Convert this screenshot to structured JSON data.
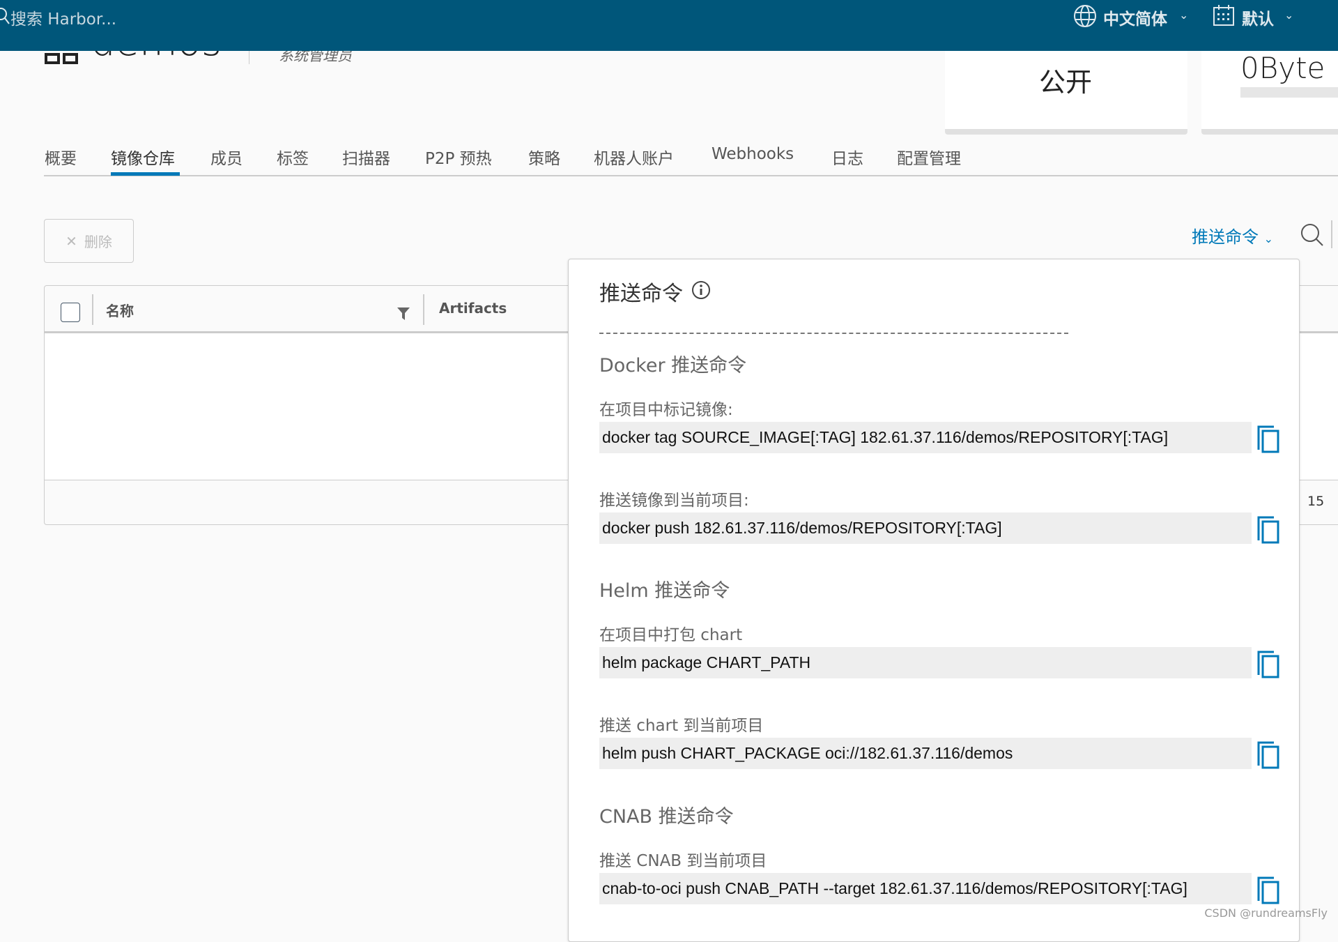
{
  "header": {
    "search_placeholder": "搜索 Harbor...",
    "language": "中文简体",
    "theme": "默认"
  },
  "project": {
    "name": "demos",
    "role": "系统管理员"
  },
  "cards": {
    "access_level": "公开",
    "quota": "0Byte"
  },
  "tabs": [
    {
      "label": "概要"
    },
    {
      "label": "镜像仓库",
      "active": true
    },
    {
      "label": "成员"
    },
    {
      "label": "标签"
    },
    {
      "label": "扫描器"
    },
    {
      "label": "P2P 预热"
    },
    {
      "label": "策略"
    },
    {
      "label": "机器人账户"
    },
    {
      "label": "Webhooks"
    },
    {
      "label": "日志"
    },
    {
      "label": "配置管理"
    }
  ],
  "toolbar": {
    "delete_label": "删除",
    "push_command_label": "推送命令"
  },
  "table": {
    "columns": [
      "名称",
      "Artifacts"
    ],
    "page_size": "15"
  },
  "push_popup": {
    "title": "推送命令",
    "sections": [
      {
        "heading": "Docker 推送命令",
        "items": [
          {
            "label": "在项目中标记镜像:",
            "command": "docker tag SOURCE_IMAGE[:TAG] 182.61.37.116/demos/REPOSITORY[:TAG]"
          },
          {
            "label": "推送镜像到当前项目:",
            "command": "docker push 182.61.37.116/demos/REPOSITORY[:TAG]"
          }
        ]
      },
      {
        "heading": "Helm 推送命令",
        "items": [
          {
            "label": "在项目中打包 chart",
            "command": "helm package CHART_PATH"
          },
          {
            "label": "推送 chart 到当前项目",
            "command": "helm push CHART_PACKAGE oci://182.61.37.116/demos"
          }
        ]
      },
      {
        "heading": "CNAB 推送命令",
        "items": [
          {
            "label": "推送 CNAB 到当前项目",
            "command": "cnab-to-oci push CNAB_PATH --target 182.61.37.116/demos/REPOSITORY[:TAG]"
          }
        ]
      }
    ]
  },
  "watermark": "CSDN @rundreamsFly",
  "colors": {
    "header": "#00567a",
    "accent": "#0079b8"
  }
}
